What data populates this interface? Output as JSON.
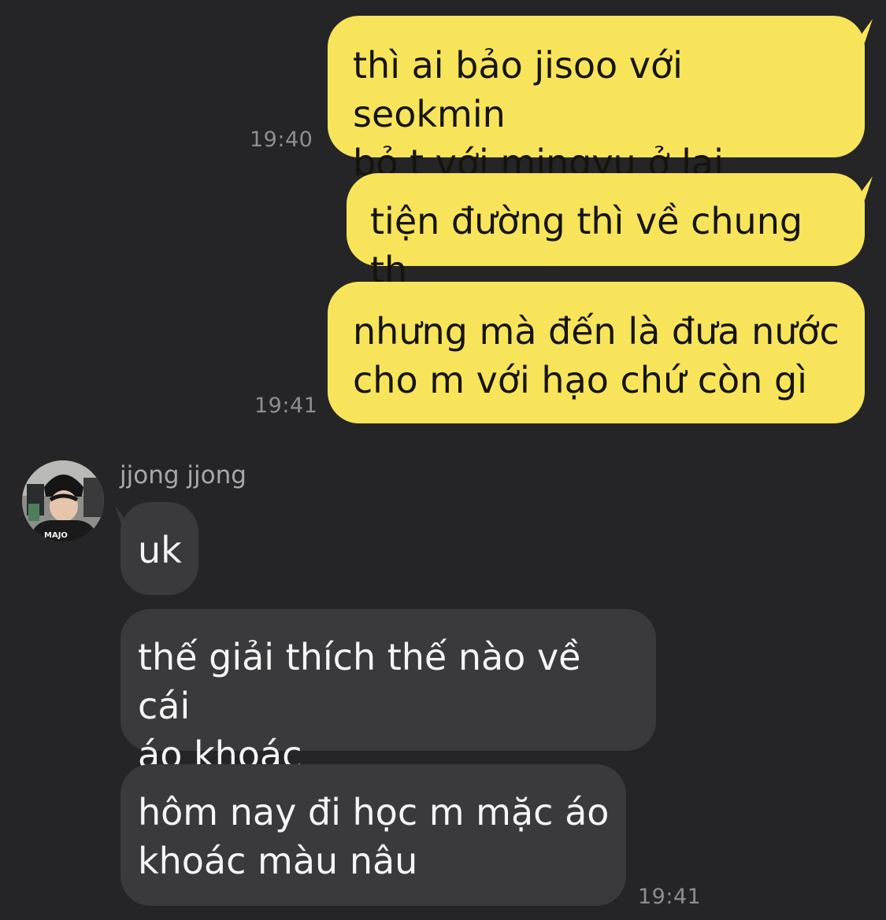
{
  "chat": {
    "outgoing": [
      {
        "text": "thì ai bảo jisoo với seokmin\nbỏ t với mingyu ở lại",
        "time": "19:40"
      },
      {
        "text": "tiện đường thì về chung th",
        "time": ""
      },
      {
        "text": "nhưng mà đến là đưa nước\ncho m với hạo chứ còn gì",
        "time": "19:41"
      }
    ],
    "contact": {
      "name": "jjong jjong",
      "avatar_icon": "profile-photo-icon"
    },
    "incoming": [
      {
        "text": "uk"
      },
      {
        "text": "thế giải thích thế nào về cái\náo khoác"
      },
      {
        "text": "hôm nay đi học m mặc áo\nkhoác màu nâu"
      }
    ],
    "incoming_time": "19:41"
  },
  "colors": {
    "background": "#252527",
    "outgoing_bubble": "#f8e45a",
    "incoming_bubble": "#3a3a3c",
    "timestamp": "#8e8e90"
  }
}
